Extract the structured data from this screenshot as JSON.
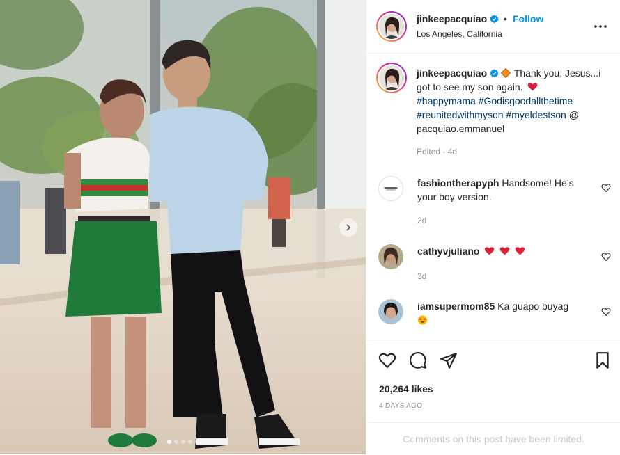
{
  "post": {
    "username": "jinkeepacquiao",
    "verified": true,
    "follow_label": "Follow",
    "separator": "•",
    "location": "Los Angeles, California",
    "more_icon": "more-horizontal-icon"
  },
  "caption": {
    "username": "jinkeepacquiao",
    "text_part1": "Thank you, Jesus...i got to see my son again.",
    "hashtags": [
      "#happymama",
      "#Godisgoodallthetime",
      "#reunitedwithmyson",
      "#myeldestson"
    ],
    "mention": "@ pacquiao.emmanuel",
    "edited": "Edited",
    "time": "4d"
  },
  "comments": [
    {
      "username": "fashiontherapyph",
      "text": "Handsome! He’s your boy version.",
      "time": "2d"
    },
    {
      "username": "cathyvjuliano",
      "text": "",
      "emoji": [
        "red-heart",
        "red-heart",
        "red-heart"
      ],
      "time": "3d"
    },
    {
      "username": "iamsupermom85",
      "text": "Ka guapo buyag",
      "emoji": [
        "star-struck"
      ]
    }
  ],
  "actions": {
    "like_icon": "heart-icon",
    "comment_icon": "comment-icon",
    "share_icon": "send-icon",
    "save_icon": "bookmark-icon"
  },
  "likes": "20,264 likes",
  "date": "4 DAYS AGO",
  "comments_limited": "Comments on this post have been limited.",
  "carousel": {
    "total": 5,
    "active": 1
  },
  "colors": {
    "follow": "#0095f6",
    "hashtag": "#00376b",
    "muted": "#8e8e8e"
  }
}
